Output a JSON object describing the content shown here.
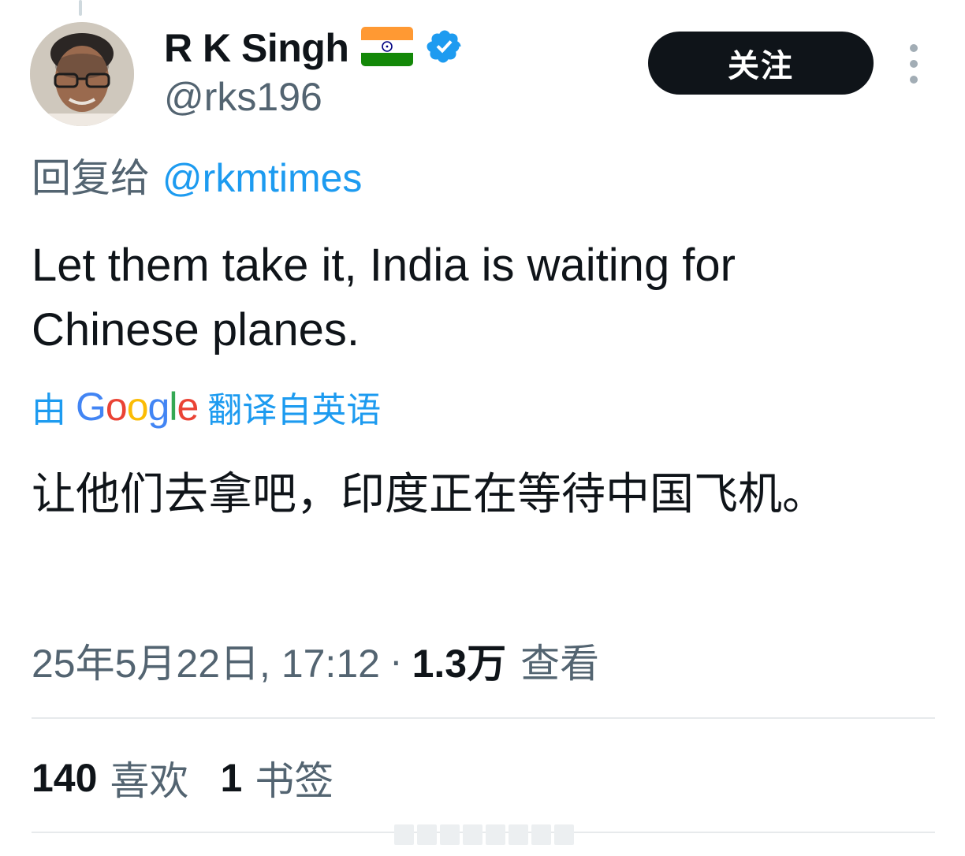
{
  "user": {
    "display_name": "R K Singh",
    "handle": "@rks196",
    "flag_icon": "india-flag-icon",
    "verified_icon": "verified-badge-icon"
  },
  "follow_button": "关注",
  "more_icon": "more-vertical-icon",
  "reply": {
    "prefix": "回复给",
    "mention": "@rkmtimes"
  },
  "tweet": {
    "text": "Let them take it, India is waiting for Chinese planes."
  },
  "translation": {
    "prefix": "由",
    "provider": "Google",
    "suffix": "翻译自英语",
    "text": "让他们去拿吧，印度正在等待中国飞机。"
  },
  "meta": {
    "timestamp": "25年5月22日, 17:12",
    "separator": "·",
    "views": "1.3万",
    "views_label": "查看"
  },
  "stats": {
    "likes": "140",
    "likes_label": "喜欢",
    "bookmarks": "1",
    "bookmarks_label": "书签"
  },
  "colors": {
    "accent": "#1d9bf0",
    "text": "#0f1419",
    "secondary": "#536471",
    "button_bg": "#0f1419",
    "divider": "#e7eaec"
  }
}
